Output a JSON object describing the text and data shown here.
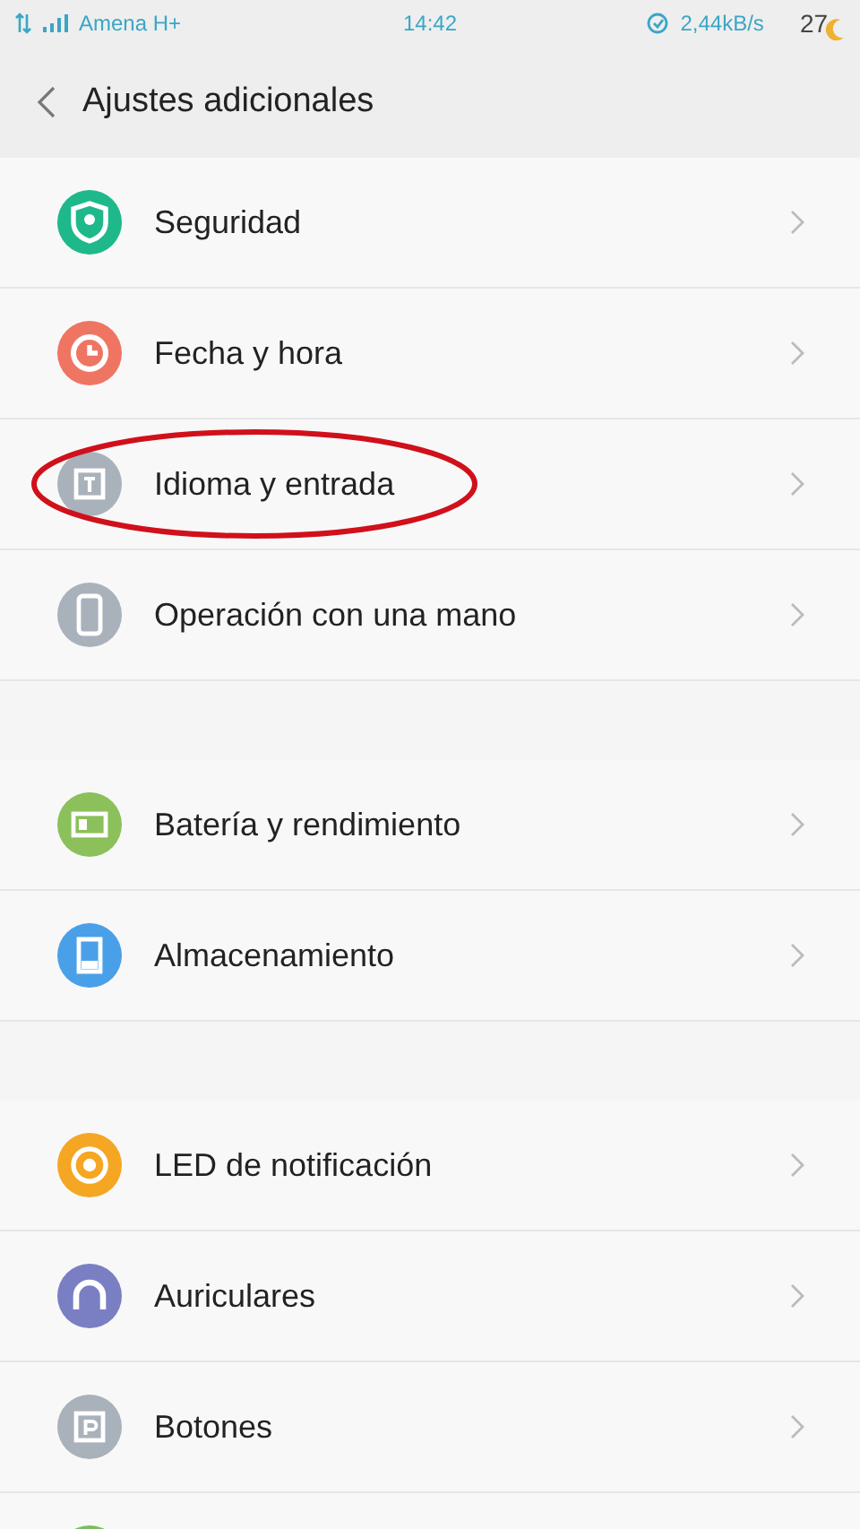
{
  "status_bar": {
    "carrier": "Amena H+",
    "time": "14:42",
    "speed": "2,44kB/s",
    "temperature": "27"
  },
  "header": {
    "title": "Ajustes adicionales"
  },
  "groups": [
    {
      "items": [
        {
          "kind": "shield",
          "color": "#1fb88a",
          "label": "Seguridad",
          "circled": false
        },
        {
          "kind": "clock",
          "color": "#ef7563",
          "label": "Fecha y hora",
          "circled": false
        },
        {
          "kind": "text",
          "color": "#a9b1bb",
          "label": "Idioma y entrada",
          "circled": true
        },
        {
          "kind": "phone",
          "color": "#a9b1bb",
          "label": "Operación con una mano",
          "circled": false
        }
      ]
    },
    {
      "items": [
        {
          "kind": "battery",
          "color": "#8cc05a",
          "label": "Batería y rendimiento",
          "circled": false
        },
        {
          "kind": "storage",
          "color": "#4aa0e8",
          "label": "Almacenamiento",
          "circled": false
        }
      ]
    },
    {
      "items": [
        {
          "kind": "led",
          "color": "#f5a623",
          "label": "LED de notificación",
          "circled": false
        },
        {
          "kind": "headphones",
          "color": "#7a7fc4",
          "label": "Auriculares",
          "circled": false
        },
        {
          "kind": "buttons",
          "color": "#a9b1bb",
          "label": "Botones",
          "circled": false
        },
        {
          "kind": "partial",
          "color": "#7cbc5c",
          "circled": false
        }
      ]
    }
  ]
}
